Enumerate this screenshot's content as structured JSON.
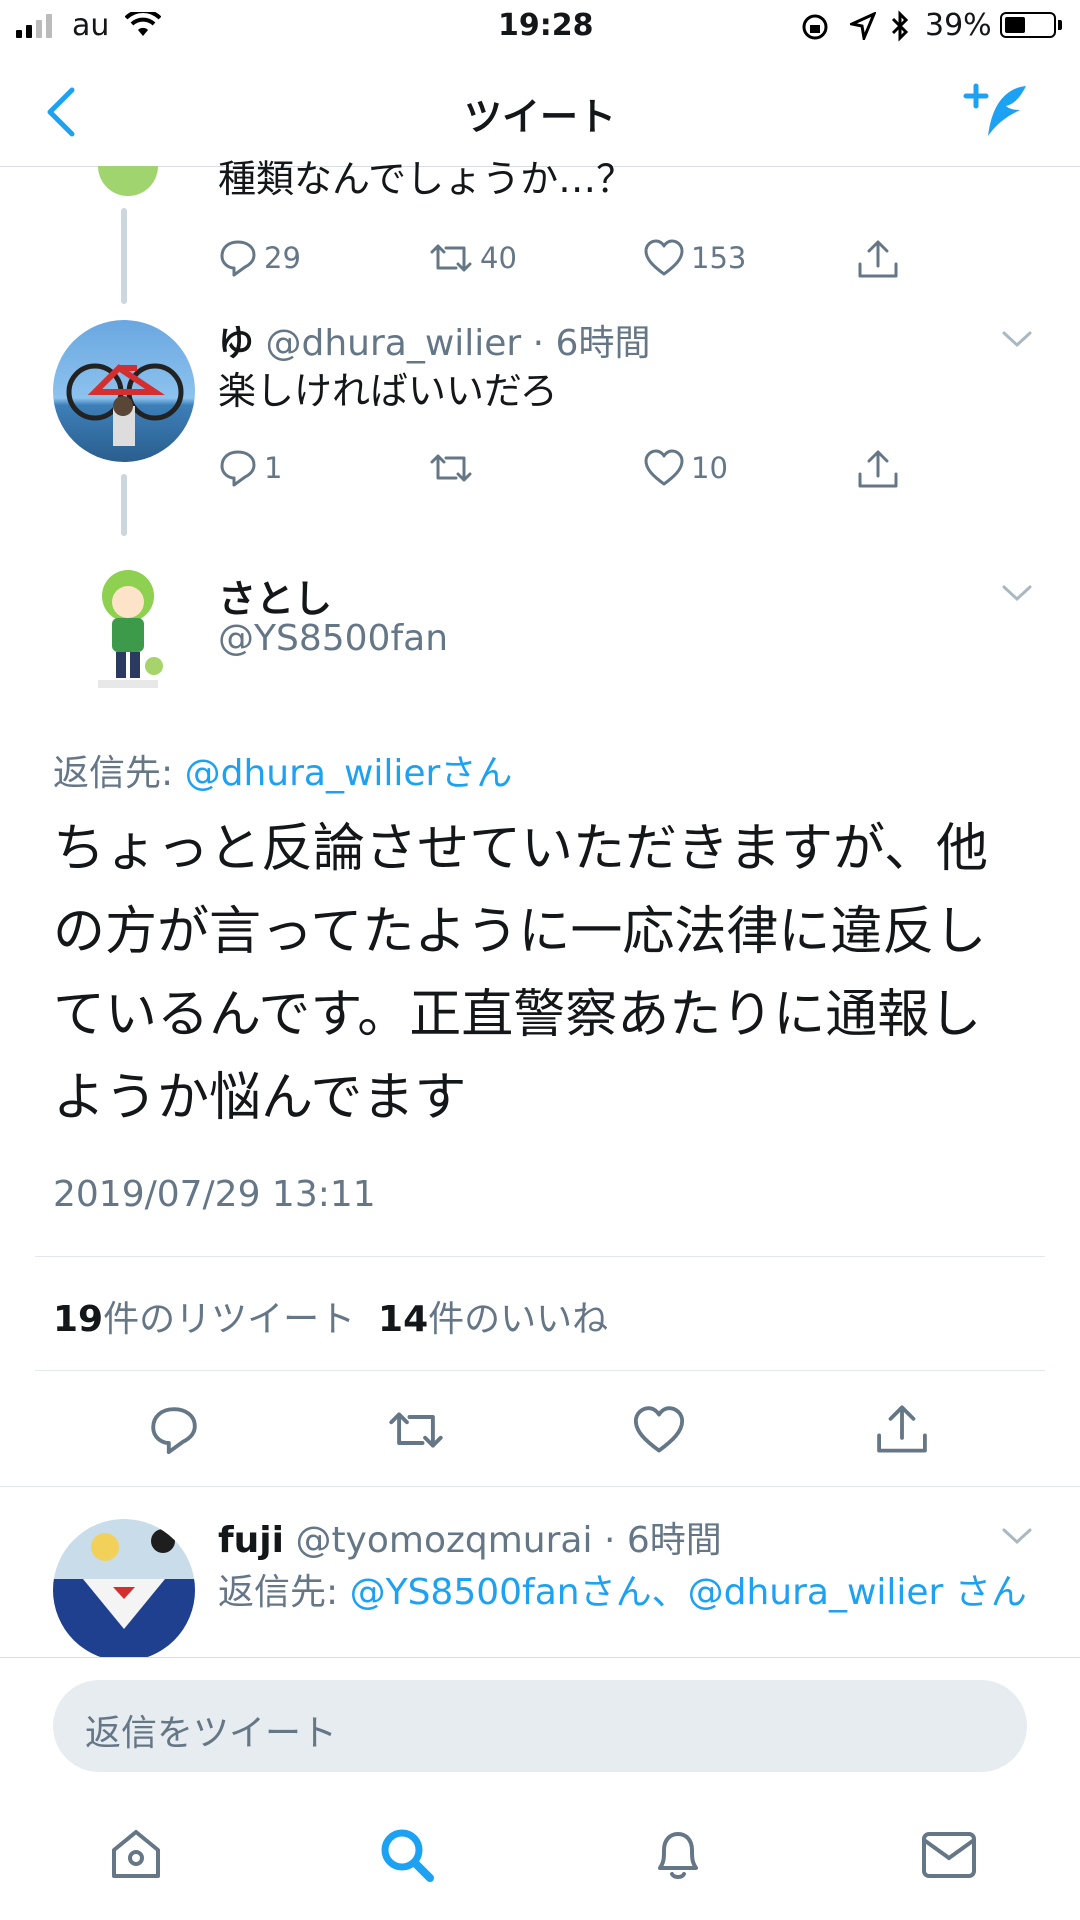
{
  "status": {
    "carrier": "au",
    "time": "19:28",
    "battery": "39%"
  },
  "nav": {
    "title": "ツイート"
  },
  "thread": {
    "prev_tweet": {
      "text_partial": "種類なんでしょうか…？",
      "reply_count": "29",
      "retweet_count": "40",
      "like_count": "153"
    },
    "reply1": {
      "name": "ゆ",
      "handle": "@dhura_wilier",
      "time": "· 6時間",
      "text": "楽しければいいだろ",
      "reply_count": "1",
      "retweet_count": "",
      "like_count": "10"
    }
  },
  "main_tweet": {
    "name": "さとし",
    "handle": "@YS8500fan",
    "reply_to_label": "返信先:",
    "reply_to_target": "@dhura_wilierさん",
    "text": "ちょっと反論させていただきますが、他の方が言ってたように一応法律に違反しているんです。正直警察あたりに通報しようか悩んでます",
    "timestamp": "2019/07/29 13:11",
    "retweets_num": "19",
    "retweets_label": "件のリツイート",
    "likes_num": "14",
    "likes_label": "件のいいね"
  },
  "reply2": {
    "name": "fuji",
    "handle": "@tyomozqmurai",
    "time": "· 6時間",
    "reply_to_label": "返信先:",
    "reply_to_target": "@YS8500fanさん、@dhura_wilier さん"
  },
  "composer": {
    "placeholder": "返信をツイート"
  },
  "tab_bar": {
    "items": [
      "home-icon",
      "search-icon",
      "notifications-icon",
      "messages-icon"
    ]
  },
  "colors": {
    "accent": "#1da1f2",
    "secondary": "#657786"
  }
}
